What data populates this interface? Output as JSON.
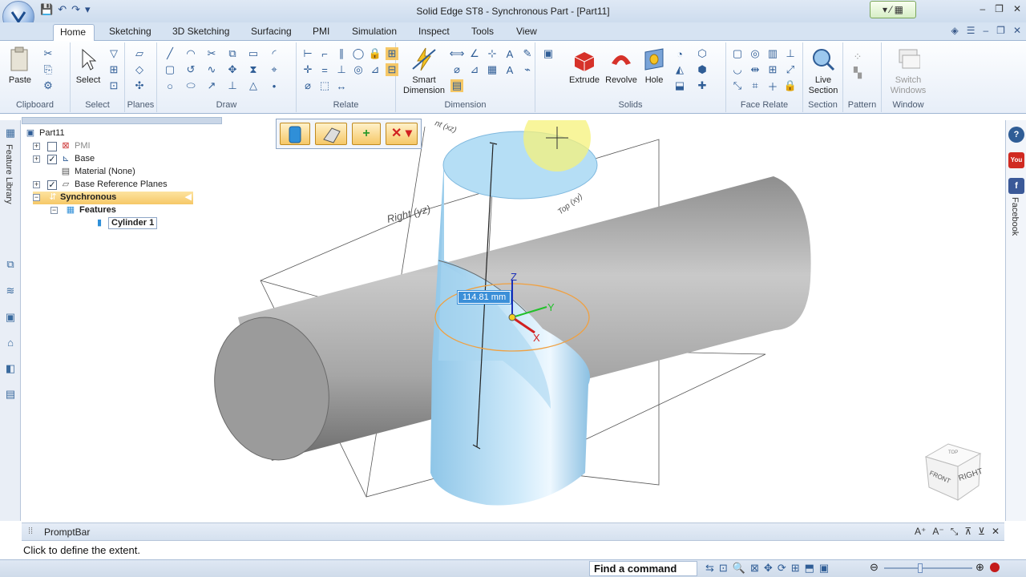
{
  "window": {
    "title": "Solid Edge ST8 - Synchronous Part - [Part11]",
    "controls": [
      "‒",
      "❐",
      "✕"
    ]
  },
  "qat": {
    "save": "💾",
    "undo": "↶",
    "redo": "↷",
    "more": "▾"
  },
  "tabs": [
    "Home",
    "Sketching",
    "3D Sketching",
    "Surfacing",
    "PMI",
    "Simulation",
    "Inspect",
    "Tools",
    "View"
  ],
  "ribbon": {
    "clipboard": {
      "paste_label": "Paste",
      "group_label": "Clipboard"
    },
    "select": {
      "select_label": "Select",
      "group_label": "Select"
    },
    "planes": {
      "group_label": "Planes"
    },
    "draw": {
      "group_label": "Draw"
    },
    "relate": {
      "group_label": "Relate"
    },
    "dimension": {
      "smart_label": "Smart Dimension",
      "group_label": "Dimension"
    },
    "solids": {
      "extrude_label": "Extrude",
      "revolve_label": "Revolve",
      "hole_label": "Hole",
      "group_label": "Solids"
    },
    "face_relate": {
      "group_label": "Face Relate"
    },
    "section": {
      "live_label": "Live Section",
      "group_label": "Section"
    },
    "pattern": {
      "group_label": "Pattern"
    },
    "window": {
      "switch_label": "Switch Windows",
      "group_label": "Window"
    }
  },
  "side_tabs": {
    "feature_library": "Feature Library",
    "facebook": "Facebook",
    "youtube": "You"
  },
  "tree": {
    "root": "Part11",
    "items": [
      {
        "label": "PMI",
        "checked": false
      },
      {
        "label": "Base",
        "checked": true
      },
      {
        "label": "Material (None)"
      },
      {
        "label": "Base Reference Planes",
        "checked": true
      },
      {
        "label": "Synchronous"
      },
      {
        "label": "Features"
      },
      {
        "label": "Cylinder 1"
      }
    ]
  },
  "viewport": {
    "dimension_value": "114.81 mm",
    "plane_labels": {
      "right": "Right (yz)",
      "top": "Top (xy)",
      "front": "nt (xz)"
    },
    "axes": {
      "x": "X",
      "y": "Y",
      "z": "Z"
    },
    "view_cube": {
      "front": "FRONT",
      "right": "RIGHT",
      "top": "TOP"
    }
  },
  "promptbar": {
    "title": "PromptBar",
    "message": "Click to define the extent."
  },
  "statusbar": {
    "find_command": "Find a command"
  },
  "colors": {
    "accent": "#f6c867",
    "brand": "#2f5d96",
    "cylinder": "#a9d6f0",
    "rod": "#a8a8a8"
  }
}
